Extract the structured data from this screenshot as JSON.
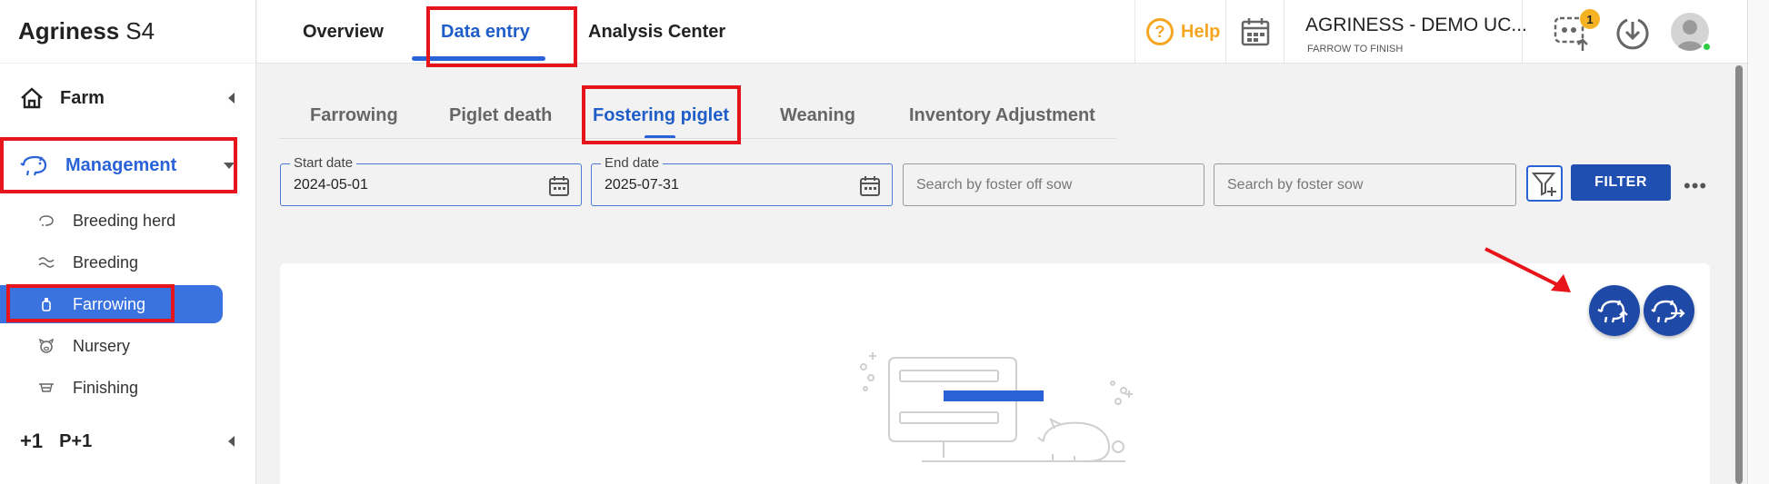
{
  "app": {
    "brand_bold": "Agriness",
    "brand_rest": "S4"
  },
  "sidebar": {
    "farm": "Farm",
    "management": "Management",
    "items": [
      {
        "label": "Breeding herd",
        "icon": "pig-icon"
      },
      {
        "label": "Breeding",
        "icon": "breeding-icon"
      },
      {
        "label": "Farrowing",
        "icon": "bottle-icon"
      },
      {
        "label": "Nursery",
        "icon": "piglet-face-icon"
      },
      {
        "label": "Finishing",
        "icon": "feeder-icon"
      }
    ],
    "p1_prefix": "+1",
    "p1": "P+1"
  },
  "topnav": {
    "tabs": [
      "Overview",
      "Data entry",
      "Analysis Center"
    ],
    "active_tab": "Data entry",
    "help": "Help",
    "help_glyph": "?",
    "farm_name": "AGRINESS - DEMO UC...",
    "farm_type": "FARROW TO FINISH",
    "notification_count": "1"
  },
  "subtabs": {
    "items": [
      "Farrowing",
      "Piglet death",
      "Fostering piglet",
      "Weaning",
      "Inventory Adjustment"
    ],
    "active": "Fostering piglet"
  },
  "filters": {
    "start_date_label": "Start date",
    "start_date": "2024-05-01",
    "end_date_label": "End date",
    "end_date": "2025-07-31",
    "foster_off_placeholder": "Search by foster off sow",
    "foster_placeholder": "Search by foster sow",
    "filter_button": "FILTER",
    "more": "•••"
  },
  "colors": {
    "accent": "#2a63d8",
    "highlight": "#e8141b",
    "help": "#f5a623",
    "fab": "#1e49a6"
  }
}
